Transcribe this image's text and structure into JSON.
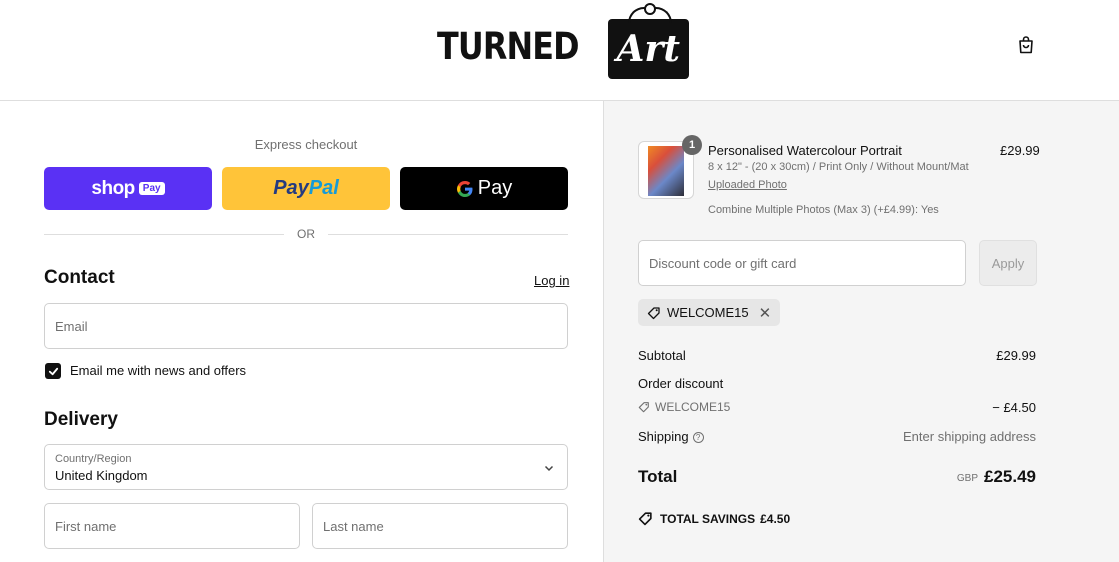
{
  "header": {
    "logo_word": "TURNED",
    "logo_script": "Art",
    "cart_icon": "shopping-bag-icon"
  },
  "express": {
    "title": "Express checkout",
    "shop_label": "shop",
    "shop_badge": "Pay",
    "paypal_part1": "Pay",
    "paypal_part2": "Pal",
    "gpay_label": "Pay",
    "or_label": "OR",
    "colors": {
      "shop": "#5a31f4",
      "paypal": "#ffc439",
      "gpay": "#000000"
    }
  },
  "contact": {
    "title": "Contact",
    "login_label": "Log in",
    "email_placeholder": "Email",
    "newsletter_label": "Email me with news and offers",
    "newsletter_checked": true
  },
  "delivery": {
    "title": "Delivery",
    "country_label": "Country/Region",
    "country_value": "United Kingdom",
    "first_name_placeholder": "First name",
    "last_name_placeholder": "Last name"
  },
  "summary": {
    "product": {
      "quantity": "1",
      "name": "Personalised Watercolour Portrait",
      "variant": "8 x 12\" - (20 x 30cm) / Print Only / Without Mount/Mat",
      "upload_link": "Uploaded Photo",
      "option": "Combine Multiple Photos (Max 3) (+£4.99): Yes",
      "price": "£29.99"
    },
    "discount_placeholder": "Discount code or gift card",
    "apply_label": "Apply",
    "applied_code": "WELCOME15",
    "subtotal_label": "Subtotal",
    "subtotal_value": "£29.99",
    "order_discount_label": "Order discount",
    "discount_code": "WELCOME15",
    "discount_value": "− £4.50",
    "shipping_label": "Shipping",
    "shipping_value": "Enter shipping address",
    "total_label": "Total",
    "currency": "GBP",
    "total_value": "£25.49",
    "savings_label": "TOTAL SAVINGS",
    "savings_value": "£4.50"
  }
}
